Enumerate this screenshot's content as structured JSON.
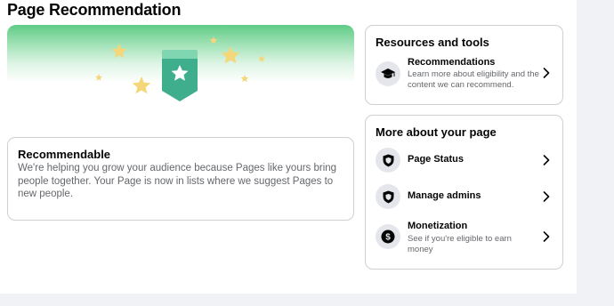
{
  "header": {
    "title": "Page Recommendation"
  },
  "recommendable": {
    "title": "Recommendable",
    "body": "We're helping you grow your audience because Pages like yours bring people together. Your Page is now in lists where we suggest Pages to new people."
  },
  "resources": {
    "heading": "Resources and tools",
    "items": [
      {
        "title": "Recommendations",
        "subtitle": "Learn more about eligibility and the content we can recommend.",
        "icon": "graduation-cap-icon"
      }
    ]
  },
  "more": {
    "heading": "More about your page",
    "items": [
      {
        "title": "Page Status",
        "icon": "shield-icon"
      },
      {
        "title": "Manage admins",
        "icon": "shield-icon"
      },
      {
        "title": "Monetization",
        "subtitle": "See if you're eligible to earn money",
        "icon": "dollar-icon"
      }
    ]
  },
  "colors": {
    "accent_green": "#5fcb86",
    "badge_green": "#3fae8c",
    "star_yellow": "#f5d77a",
    "text_secondary": "#65676b"
  }
}
